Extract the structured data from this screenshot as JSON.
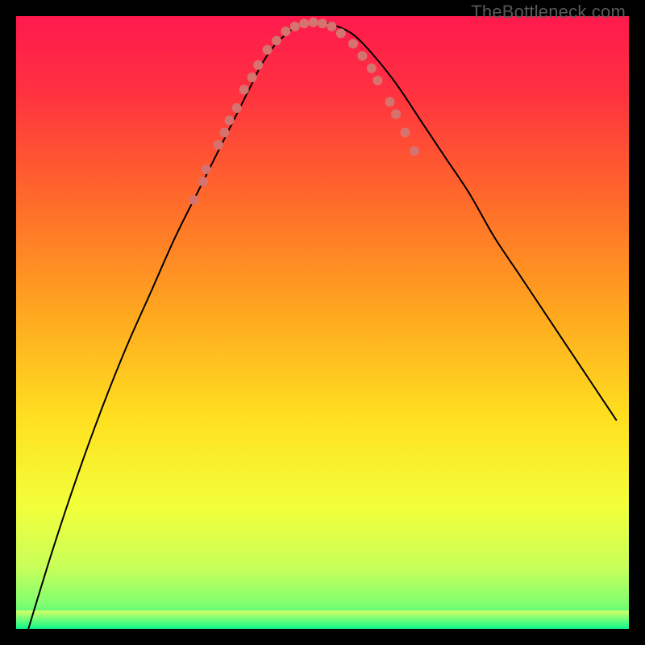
{
  "watermark": "TheBottleneck.com",
  "chart_data": {
    "type": "line",
    "title": "",
    "xlabel": "",
    "ylabel": "",
    "xlim": [
      0,
      100
    ],
    "ylim": [
      0,
      100
    ],
    "grid": false,
    "background_gradient": {
      "stops": [
        {
          "offset": 0.0,
          "color": "#ff1a4d"
        },
        {
          "offset": 0.12,
          "color": "#ff3040"
        },
        {
          "offset": 0.3,
          "color": "#ff6a2a"
        },
        {
          "offset": 0.48,
          "color": "#ffa61f"
        },
        {
          "offset": 0.66,
          "color": "#ffe120"
        },
        {
          "offset": 0.8,
          "color": "#f2ff3a"
        },
        {
          "offset": 0.9,
          "color": "#c8ff5a"
        },
        {
          "offset": 0.96,
          "color": "#80ff70"
        },
        {
          "offset": 1.0,
          "color": "#11f58a"
        }
      ]
    },
    "green_band": {
      "top_y_pct": 97.0,
      "colors": [
        "#d9ff66",
        "#6bff7a",
        "#11f58a"
      ]
    },
    "series": [
      {
        "name": "bottleneck-curve",
        "x": [
          2,
          6,
          10,
          14,
          18,
          22,
          26,
          30,
          33,
          36,
          38,
          40,
          42,
          44,
          46,
          48,
          50,
          52,
          55,
          58,
          62,
          66,
          70,
          74,
          78,
          82,
          86,
          90,
          94,
          98
        ],
        "y": [
          0,
          13,
          25,
          36,
          46,
          55,
          64,
          72,
          78,
          84,
          88,
          92,
          95,
          97,
          98.5,
          99,
          99,
          98.5,
          97,
          94,
          89,
          83,
          77,
          71,
          64,
          58,
          52,
          46,
          40,
          34
        ],
        "stroke": "#000000",
        "stroke_width": 2
      }
    ],
    "markers": {
      "color": "#d6736f",
      "radius": 6,
      "points": [
        {
          "x": 29.0,
          "y": 70
        },
        {
          "x": 30.5,
          "y": 73
        },
        {
          "x": 31.0,
          "y": 75
        },
        {
          "x": 33.0,
          "y": 79
        },
        {
          "x": 34.0,
          "y": 81
        },
        {
          "x": 34.8,
          "y": 83
        },
        {
          "x": 36.0,
          "y": 85
        },
        {
          "x": 37.2,
          "y": 88
        },
        {
          "x": 38.5,
          "y": 90
        },
        {
          "x": 39.5,
          "y": 92
        },
        {
          "x": 41.0,
          "y": 94.5
        },
        {
          "x": 42.5,
          "y": 96
        },
        {
          "x": 44.0,
          "y": 97.5
        },
        {
          "x": 45.5,
          "y": 98.3
        },
        {
          "x": 47.0,
          "y": 98.8
        },
        {
          "x": 48.5,
          "y": 99
        },
        {
          "x": 50.0,
          "y": 98.8
        },
        {
          "x": 51.5,
          "y": 98.3
        },
        {
          "x": 53.0,
          "y": 97.2
        },
        {
          "x": 55.0,
          "y": 95.5
        },
        {
          "x": 56.5,
          "y": 93.5
        },
        {
          "x": 58.0,
          "y": 91.5
        },
        {
          "x": 59.0,
          "y": 89.5
        },
        {
          "x": 61.0,
          "y": 86
        },
        {
          "x": 62.0,
          "y": 84
        },
        {
          "x": 63.5,
          "y": 81
        },
        {
          "x": 65.0,
          "y": 78
        }
      ]
    }
  }
}
